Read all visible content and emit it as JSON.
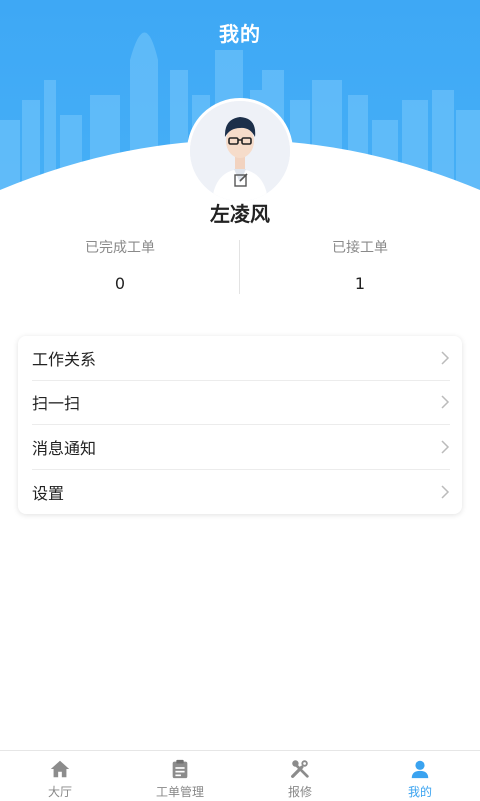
{
  "header": {
    "title": "我的"
  },
  "profile": {
    "name": "左凌风"
  },
  "stats": [
    {
      "label": "已完成工单",
      "value": "0"
    },
    {
      "label": "已接工单",
      "value": "1"
    }
  ],
  "menu": [
    {
      "label": "工作关系"
    },
    {
      "label": "扫一扫"
    },
    {
      "label": "消息通知"
    },
    {
      "label": "设置"
    }
  ],
  "tabbar": {
    "active": "我的",
    "tabs": [
      {
        "label": "大厅",
        "icon": "home-icon"
      },
      {
        "label": "工单管理",
        "icon": "clipboard-icon"
      },
      {
        "label": "报修",
        "icon": "tools-icon"
      },
      {
        "label": "我的",
        "icon": "person-icon"
      }
    ]
  },
  "colors": {
    "primary": "#3aa3f0",
    "header_bg": "#3fa9f5"
  }
}
